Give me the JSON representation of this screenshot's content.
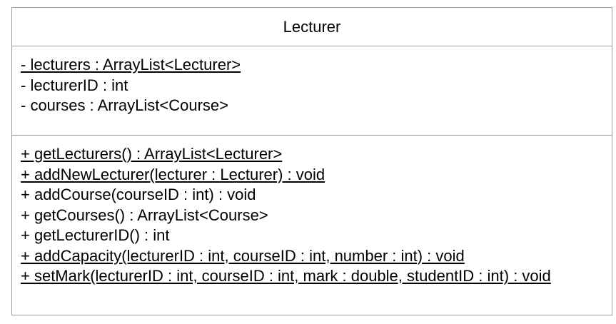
{
  "class": {
    "name": "Lecturer",
    "attributes": [
      {
        "text": "- lecturers : ArrayList<Lecturer>",
        "static": true
      },
      {
        "text": "- lecturerID : int",
        "static": false
      },
      {
        "text": "- courses : ArrayList<Course>",
        "static": false
      }
    ],
    "operations": [
      {
        "text": "+ getLecturers() : ArrayList<Lecturer>",
        "static": true
      },
      {
        "text": "+ addNewLecturer(lecturer : Lecturer) : void",
        "static": true
      },
      {
        "text": "+ addCourse(courseID : int) : void",
        "static": false
      },
      {
        "text": "+ getCourses() : ArrayList<Course>",
        "static": false
      },
      {
        "text": "+ getLecturerID() : int",
        "static": false
      },
      {
        "text": "+ addCapacity(lecturerID : int, courseID : int, number : int) : void",
        "static": true
      },
      {
        "text": "+ setMark(lecturerID : int, courseID : int, mark : double, studentID : int) : void",
        "static": true
      }
    ]
  }
}
